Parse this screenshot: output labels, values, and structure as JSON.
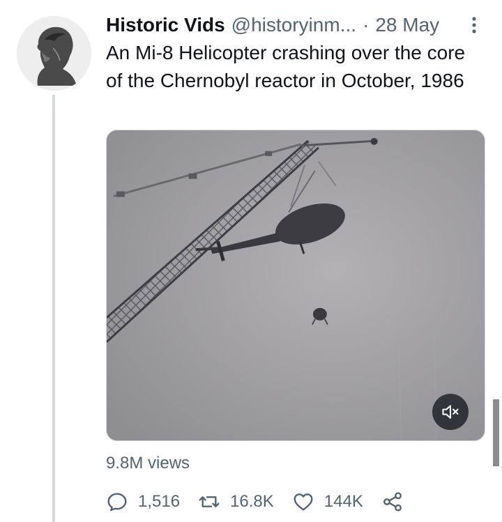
{
  "author": {
    "display_name": "Historic Vids",
    "handle": "@historyinm...",
    "separator": "·",
    "timestamp": "28 May"
  },
  "tweet": {
    "text": "An Mi-8 Helicopter crashing over the core of the Chernobyl reactor in October, 1986"
  },
  "media": {
    "type": "video",
    "muted": true
  },
  "stats": {
    "views": "9.8M views"
  },
  "actions": {
    "replies": "1,516",
    "retweets": "16.8K",
    "likes": "144K"
  },
  "colors": {
    "secondary_text": "#536471",
    "primary_text": "#0f1419",
    "thread_line": "#cfd9de"
  },
  "icons": [
    "more-icon",
    "mute-icon",
    "reply-icon",
    "retweet-icon",
    "like-icon",
    "share-icon"
  ]
}
